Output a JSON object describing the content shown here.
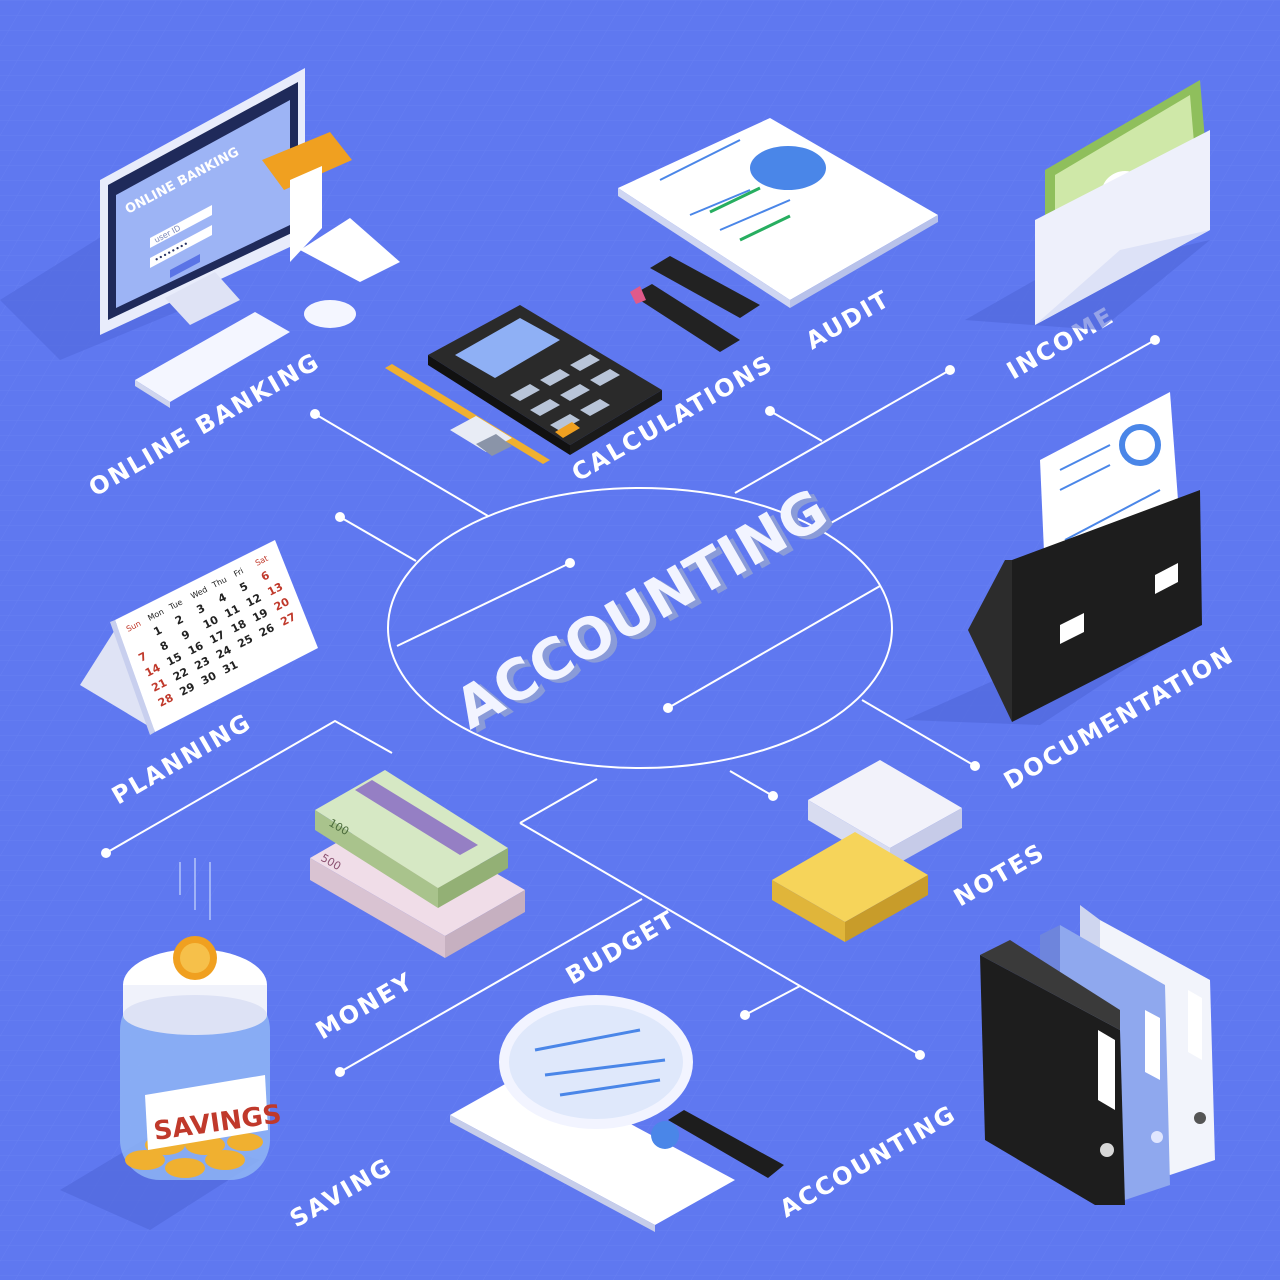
{
  "center_title": "ACCOUNTING",
  "labels": {
    "online_banking": "ONLINE BANKING",
    "calculations": "CALCULATIONS",
    "audit": "AUDIT",
    "income": "INCOME",
    "planning": "PLANNING",
    "documentation": "DOCUMENTATION",
    "notes": "NOTES",
    "money": "MONEY",
    "budget": "BUDGET",
    "saving": "SAVING",
    "accounting": "ACCOUNTING"
  },
  "monitor": {
    "title": "ONLINE BANKING",
    "user_placeholder": "user ID",
    "password_mask": "••••••••"
  },
  "calendar": {
    "days": [
      "Sun",
      "Mon",
      "Tue",
      "Wed",
      "Thu",
      "Fri",
      "Sat"
    ],
    "row1": [
      "",
      "",
      "",
      "",
      "",
      "",
      "6"
    ],
    "rows": [
      [
        "",
        "1",
        "2",
        "3",
        "4",
        "5",
        "6"
      ],
      [
        "7",
        "8",
        "9",
        "10",
        "11",
        "12",
        "13"
      ],
      [
        "14",
        "15",
        "16",
        "17",
        "18",
        "19",
        "20"
      ],
      [
        "21",
        "22",
        "23",
        "24",
        "25",
        "26",
        "27"
      ],
      [
        "28",
        "29",
        "30",
        "31",
        "",
        "",
        ""
      ]
    ]
  },
  "jar_label": "SAVINGS",
  "banknotes": {
    "usd": "100",
    "eur": "500"
  },
  "colors": {
    "background": "#5f78f0",
    "line": "#ffffff",
    "accent_blue": "#4a86e8",
    "orange": "#f0a020",
    "black_folder": "#1d1d1d"
  }
}
